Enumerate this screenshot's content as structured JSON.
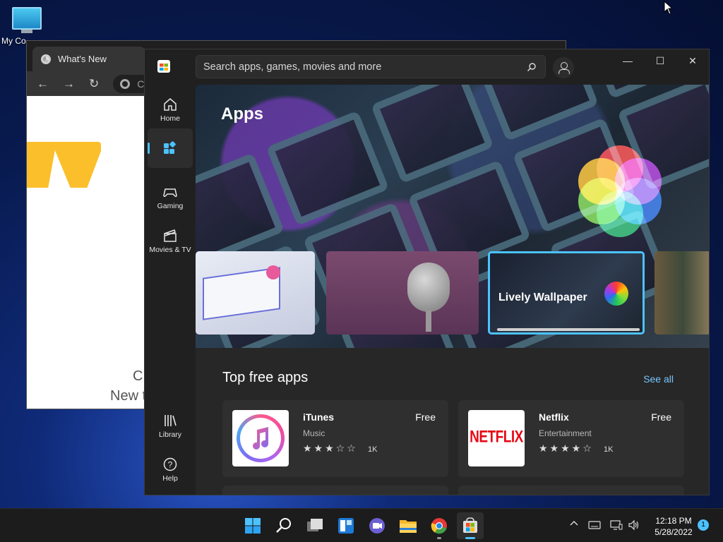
{
  "desktop": {
    "icon_label": "My Co"
  },
  "chrome": {
    "tab_title": "What's New",
    "omnibox_text": "Chro",
    "content_line1": "C",
    "content_line2": "New t"
  },
  "store": {
    "search_placeholder": "Search apps, games, movies and more",
    "nav": [
      {
        "label": "Home"
      },
      {
        "label": ""
      },
      {
        "label": "Gaming"
      },
      {
        "label": "Movies & TV"
      },
      {
        "label": "Library"
      },
      {
        "label": "Help"
      }
    ],
    "hero_title": "Apps",
    "carousel_featured_label": "Lively Wallpaper",
    "carousel_progress": 1.0,
    "section_title": "Top free apps",
    "see_all": "See all",
    "apps": [
      {
        "name": "iTunes",
        "price": "Free",
        "category": "Music",
        "rating": 3,
        "rating_max": 5,
        "count": "1K"
      },
      {
        "name": "Netflix",
        "price": "Free",
        "category": "Entertainment",
        "rating": 4,
        "rating_max": 5,
        "count": "1K"
      }
    ],
    "netflix_logo_text": "NETFLIX"
  },
  "taskbar": {
    "time": "12:18 PM",
    "date": "5/28/2022",
    "notification_count": "1"
  },
  "colors": {
    "accent": "#4cc2ff",
    "link": "#74c6ff",
    "netflix_red": "#e50914"
  }
}
